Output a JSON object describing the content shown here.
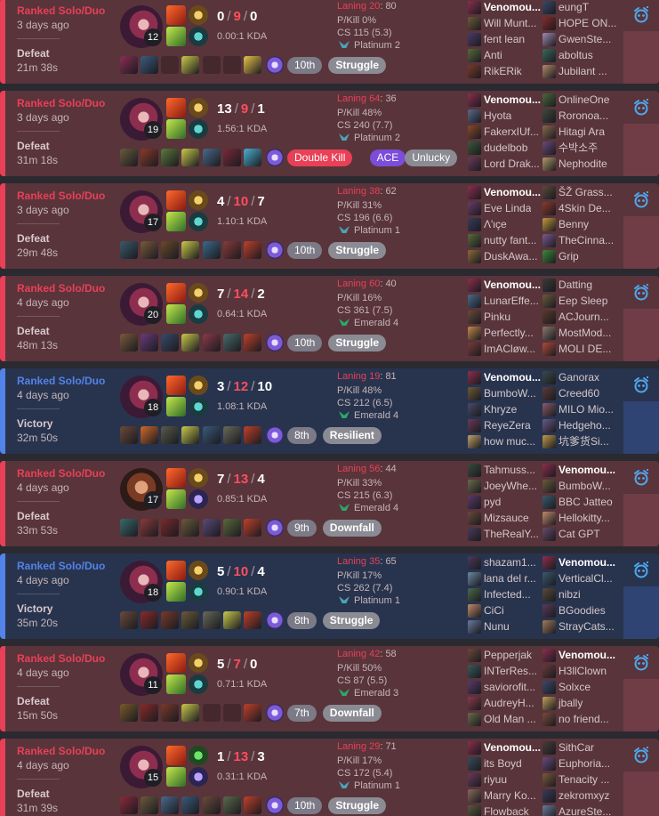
{
  "colors": {
    "defeat_accent": "#e84057",
    "victory_accent": "#5383e8",
    "defeat_bg": "#59343b",
    "victory_bg": "#28344e"
  },
  "matches": [
    {
      "result_class": "defeat",
      "queue": "Ranked Solo/Duo",
      "ago": "3 days ago",
      "result": "Defeat",
      "duration": "21m 38s",
      "champion": "c-irelia",
      "level": "12",
      "spells": [
        "spell-ignite",
        "spell-ghost"
      ],
      "runes": [
        "rune-conqueror",
        "rune-resolve"
      ],
      "kills": "0",
      "deaths": "9",
      "assists": "0",
      "kda_ratio": "0.00:1 KDA",
      "items": [
        "#8a2e52",
        "#3a5c7c",
        "empty",
        "#c9c94a",
        "empty",
        "empty",
        "#e7c34a",
        "ward"
      ],
      "badges": [
        {
          "text": "10th",
          "kind": "place"
        },
        {
          "text": "Struggle",
          "kind": "mood"
        }
      ],
      "laning_label": "Laning 20",
      "laning_rest": ": 80",
      "p_kill": "P/Kill 0%",
      "cs": "CS 115 (5.3)",
      "rank": "Platinum 2",
      "rank_emblem": "plat",
      "team1": [
        {
          "name": "Venomou...",
          "me": true,
          "c": "#8d2e4e"
        },
        {
          "name": "Will Munt...",
          "c": "#6e5a3a"
        },
        {
          "name": "fent lean",
          "c": "#4a3a6a"
        },
        {
          "name": "Anti",
          "c": "#5a6a3a"
        },
        {
          "name": "RikERik",
          "c": "#7a3a2a"
        }
      ],
      "team2": [
        {
          "name": "eungT",
          "c": "#3a4a6a"
        },
        {
          "name": "HOPE ON...",
          "c": "#8a2a2a"
        },
        {
          "name": "GwenSte...",
          "c": "#a08ab0"
        },
        {
          "name": "aboltus",
          "c": "#3a6a5a"
        },
        {
          "name": "Jubilant ...",
          "c": "#b08a6a"
        }
      ]
    },
    {
      "result_class": "defeat",
      "queue": "Ranked Solo/Duo",
      "ago": "3 days ago",
      "result": "Defeat",
      "duration": "31m 18s",
      "champion": "c-irelia",
      "level": "19",
      "spells": [
        "spell-ignite",
        "spell-ghost"
      ],
      "runes": [
        "rune-conqueror",
        "rune-resolve"
      ],
      "kills": "13",
      "deaths": "9",
      "assists": "1",
      "kda_ratio": "1.56:1 KDA",
      "items": [
        "#6a5a3a",
        "#8a3a2a",
        "#5a7a3a",
        "#c9c94a",
        "#4a6a8a",
        "#7a2a3a",
        "#4ab0d0",
        "ward"
      ],
      "badges": [
        {
          "text": "Double Kill",
          "kind": "multi"
        },
        {
          "text": "ACE",
          "kind": "ace"
        },
        {
          "text": "Unlucky",
          "kind": "unlucky"
        }
      ],
      "laning_label": "Laning 64",
      "laning_rest": ": 36",
      "p_kill": "P/Kill 48%",
      "cs": "CS 240 (7.7)",
      "rank": "Platinum 2",
      "rank_emblem": "plat",
      "team1": [
        {
          "name": "Venomou...",
          "me": true,
          "c": "#8d2e4e"
        },
        {
          "name": "Hyota",
          "c": "#5a6a8a"
        },
        {
          "name": "FakerxIUf...",
          "c": "#8a4a2a"
        },
        {
          "name": "dudelbob",
          "c": "#3a5a3a"
        },
        {
          "name": "Lord Drak...",
          "c": "#6a3a5a"
        }
      ],
      "team2": [
        {
          "name": "OnlineOne",
          "c": "#4a6a3a"
        },
        {
          "name": "Roronoa...",
          "c": "#3a4a3a"
        },
        {
          "name": "Hitagi Ara",
          "c": "#8a6a4a"
        },
        {
          "name": "수박소주",
          "c": "#6a4a7a"
        },
        {
          "name": "Nephodite",
          "c": "#b09a6a"
        }
      ]
    },
    {
      "result_class": "defeat",
      "queue": "Ranked Solo/Duo",
      "ago": "3 days ago",
      "result": "Defeat",
      "duration": "29m 48s",
      "champion": "c-irelia",
      "level": "17",
      "spells": [
        "spell-ignite",
        "spell-ghost"
      ],
      "runes": [
        "rune-conqueror",
        "rune-resolve"
      ],
      "kills": "4",
      "deaths": "10",
      "assists": "7",
      "kda_ratio": "1.10:1 KDA",
      "items": [
        "#3a5a6a",
        "#7a5a3a",
        "#6a4a2a",
        "#c9c94a",
        "#3a6a8a",
        "#8a3a3a",
        "#c0402a",
        "ward"
      ],
      "badges": [
        {
          "text": "10th",
          "kind": "place"
        },
        {
          "text": "Struggle",
          "kind": "mood"
        }
      ],
      "laning_label": "Laning 38",
      "laning_rest": ": 62",
      "p_kill": "P/Kill 31%",
      "cs": "CS 196 (6.6)",
      "rank": "Platinum 1",
      "rank_emblem": "plat",
      "team1": [
        {
          "name": "Venomou...",
          "me": true,
          "c": "#8d2e4e"
        },
        {
          "name": "Eve Linda",
          "c": "#6a3a6a"
        },
        {
          "name": "Λ'ιçe",
          "c": "#3a3a5a"
        },
        {
          "name": "nutty fant...",
          "c": "#5a6a3a"
        },
        {
          "name": "DuskAwa...",
          "c": "#8a6a3a"
        }
      ],
      "team2": [
        {
          "name": "ŠŽ Grass...",
          "c": "#5a4a3a"
        },
        {
          "name": "4Skin De...",
          "c": "#8a3a2a"
        },
        {
          "name": "Benny",
          "c": "#c09a3a"
        },
        {
          "name": "TheCinna...",
          "c": "#7a5a8a"
        },
        {
          "name": "Grip",
          "c": "#3a8a3a"
        }
      ]
    },
    {
      "result_class": "defeat",
      "queue": "Ranked Solo/Duo",
      "ago": "4 days ago",
      "result": "Defeat",
      "duration": "48m 13s",
      "champion": "c-irelia",
      "level": "20",
      "spells": [
        "spell-ignite",
        "spell-ghost"
      ],
      "runes": [
        "rune-conqueror",
        "rune-resolve"
      ],
      "kills": "7",
      "deaths": "14",
      "assists": "2",
      "kda_ratio": "0.64:1 KDA",
      "items": [
        "#7a5a3a",
        "#6a3a7a",
        "#3a4a6a",
        "#c9c94a",
        "#8a3a4a",
        "#4a6a6a",
        "#c0402a",
        "ward"
      ],
      "badges": [
        {
          "text": "10th",
          "kind": "place"
        },
        {
          "text": "Struggle",
          "kind": "mood"
        }
      ],
      "laning_label": "Laning 60",
      "laning_rest": ": 40",
      "p_kill": "P/Kill 16%",
      "cs": "CS 361 (7.5)",
      "rank": "Emerald 4",
      "rank_emblem": "emer",
      "team1": [
        {
          "name": "Venomou...",
          "me": true,
          "c": "#8d2e4e"
        },
        {
          "name": "LunarEffe...",
          "c": "#4a6a8a"
        },
        {
          "name": "Pinku",
          "c": "#6a4a3a"
        },
        {
          "name": "Perfectly...",
          "c": "#c08a4a"
        },
        {
          "name": "ImACløw...",
          "c": "#7a3a3a"
        }
      ],
      "team2": [
        {
          "name": "Datting",
          "c": "#3a3a3a"
        },
        {
          "name": "Eep Sleep",
          "c": "#6a5a3a"
        },
        {
          "name": "ACJourn...",
          "c": "#5a3a2a"
        },
        {
          "name": "MostMod...",
          "c": "#8a7a6a"
        },
        {
          "name": "MOLI DE...",
          "c": "#b04a3a"
        }
      ]
    },
    {
      "result_class": "victory",
      "queue": "Ranked Solo/Duo",
      "ago": "4 days ago",
      "result": "Victory",
      "duration": "32m 50s",
      "champion": "c-irelia",
      "level": "18",
      "spells": [
        "spell-ignite",
        "spell-ghost"
      ],
      "runes": [
        "rune-conqueror",
        "rune-resolve"
      ],
      "kills": "3",
      "deaths": "12",
      "assists": "10",
      "kda_ratio": "1.08:1 KDA",
      "items": [
        "#6a4a3a",
        "#d06a2a",
        "#5a5a4a",
        "#c9c94a",
        "#3a5a7a",
        "#6a6a5a",
        "#c0402a",
        "ward"
      ],
      "badges": [
        {
          "text": "8th",
          "kind": "place"
        },
        {
          "text": "Resilient",
          "kind": "mood"
        }
      ],
      "laning_label": "Laning 19",
      "laning_rest": ": 81",
      "p_kill": "P/Kill 48%",
      "cs": "CS 212 (6.5)",
      "rank": "Emerald 4",
      "rank_emblem": "emer",
      "team1": [
        {
          "name": "Venomou...",
          "me": true,
          "c": "#8d2e4e"
        },
        {
          "name": "BumboW...",
          "c": "#6a5a3a"
        },
        {
          "name": "Khryze",
          "c": "#4a4a6a"
        },
        {
          "name": "ReyeZera",
          "c": "#6a3a5a"
        },
        {
          "name": "how muc...",
          "c": "#c0a06a"
        }
      ],
      "team2": [
        {
          "name": "Ganorax",
          "c": "#3a4a4a"
        },
        {
          "name": "Creed60",
          "c": "#5a3a3a"
        },
        {
          "name": "MILO Mio...",
          "c": "#8a5a6a"
        },
        {
          "name": "Hedgeho...",
          "c": "#6a5a8a"
        },
        {
          "name": "坑爹货Si...",
          "c": "#c09a4a"
        }
      ]
    },
    {
      "result_class": "defeat",
      "queue": "Ranked Solo/Duo",
      "ago": "4 days ago",
      "result": "Defeat",
      "duration": "33m 53s",
      "champion": "c-darius",
      "level": "17",
      "spells": [
        "spell-ignite",
        "spell-ghost"
      ],
      "runes": [
        "rune-conqueror",
        "rune-sorcery"
      ],
      "kills": "7",
      "deaths": "13",
      "assists": "4",
      "kda_ratio": "0.85:1 KDA",
      "items": [
        "#3a6a6a",
        "#8a3a3a",
        "#7a2a2a",
        "#6a5a3a",
        "#5a4a7a",
        "#5a6a3a",
        "#c0402a",
        "ward"
      ],
      "badges": [
        {
          "text": "9th",
          "kind": "place"
        },
        {
          "text": "Downfall",
          "kind": "mood"
        }
      ],
      "laning_label": "Laning 56",
      "laning_rest": ": 44",
      "p_kill": "P/Kill 33%",
      "cs": "CS 215 (6.3)",
      "rank": "Emerald 4",
      "rank_emblem": "emer",
      "team1": [
        {
          "name": "Tahmuss...",
          "c": "#3a4a3a"
        },
        {
          "name": "JoeyWhe...",
          "c": "#6a6a4a"
        },
        {
          "name": "pyd",
          "c": "#5a3a6a"
        },
        {
          "name": "Mizsauce",
          "c": "#6a4a3a"
        },
        {
          "name": "TheRealY...",
          "c": "#4a3a5a"
        }
      ],
      "team2": [
        {
          "name": "Venomou...",
          "me": true,
          "c": "#8d2e4e"
        },
        {
          "name": "BumboW...",
          "c": "#6a5a3a"
        },
        {
          "name": "BBC Jatteo",
          "c": "#3a5a6a"
        },
        {
          "name": "Hellokitty...",
          "c": "#c08a6a"
        },
        {
          "name": "Cat GPT",
          "c": "#6a4a6a"
        }
      ]
    },
    {
      "result_class": "victory",
      "queue": "Ranked Solo/Duo",
      "ago": "4 days ago",
      "result": "Victory",
      "duration": "35m 20s",
      "champion": "c-irelia",
      "level": "18",
      "spells": [
        "spell-ignite",
        "spell-ghost"
      ],
      "runes": [
        "rune-conqueror",
        "rune-resolve"
      ],
      "kills": "5",
      "deaths": "10",
      "assists": "4",
      "kda_ratio": "0.90:1 KDA",
      "items": [
        "#6a4a3a",
        "#8a2a2a",
        "#7a3a2a",
        "#6a5a3a",
        "#6a6a5a",
        "#c9c94a",
        "#c0402a",
        "ward"
      ],
      "badges": [
        {
          "text": "8th",
          "kind": "place"
        },
        {
          "text": "Struggle",
          "kind": "mood"
        }
      ],
      "laning_label": "Laning 35",
      "laning_rest": ": 65",
      "p_kill": "P/Kill 17%",
      "cs": "CS 262 (7.4)",
      "rank": "Platinum 1",
      "rank_emblem": "plat",
      "team1": [
        {
          "name": "shazam1...",
          "c": "#4a3a5a"
        },
        {
          "name": "lana del r...",
          "c": "#6a8aa0"
        },
        {
          "name": "Infected...",
          "c": "#4a6a4a"
        },
        {
          "name": "CiCi",
          "c": "#c08a6a"
        },
        {
          "name": "Nunu",
          "c": "#6a7aa0"
        }
      ],
      "team2": [
        {
          "name": "Venomou...",
          "me": true,
          "c": "#8d2e4e"
        },
        {
          "name": "VerticalCl...",
          "c": "#3a5a6a"
        },
        {
          "name": "nibzi",
          "c": "#5a4a3a"
        },
        {
          "name": "BGoodies",
          "c": "#5a3a5a"
        },
        {
          "name": "StrayCats...",
          "c": "#a07a5a"
        }
      ]
    },
    {
      "result_class": "defeat",
      "queue": "Ranked Solo/Duo",
      "ago": "4 days ago",
      "result": "Defeat",
      "duration": "15m 50s",
      "champion": "c-irelia",
      "level": "11",
      "spells": [
        "spell-ignite",
        "spell-ghost"
      ],
      "runes": [
        "rune-conqueror",
        "rune-resolve"
      ],
      "kills": "5",
      "deaths": "7",
      "assists": "0",
      "kda_ratio": "0.71:1 KDA",
      "items": [
        "#7a5a2a",
        "#8a2a2a",
        "#7a3a2a",
        "#c9c94a",
        "empty",
        "empty",
        "#c0402a",
        "ward"
      ],
      "badges": [
        {
          "text": "7th",
          "kind": "place"
        },
        {
          "text": "Downfall",
          "kind": "mood"
        }
      ],
      "laning_label": "Laning 42",
      "laning_rest": ": 58",
      "p_kill": "P/Kill 50%",
      "cs": "CS 87 (5.5)",
      "rank": "Emerald 3",
      "rank_emblem": "emer",
      "team1": [
        {
          "name": "Pepperjak",
          "c": "#6a4a3a"
        },
        {
          "name": "INTerRes...",
          "c": "#3a5a5a"
        },
        {
          "name": "saviorofit...",
          "c": "#5a3a6a"
        },
        {
          "name": "AudreyH...",
          "c": "#8a3a4a"
        },
        {
          "name": "Old Man ...",
          "c": "#6a6a4a"
        }
      ],
      "team2": [
        {
          "name": "Venomou...",
          "me": true,
          "c": "#8d2e4e"
        },
        {
          "name": "H3llClown",
          "c": "#6a3a3a"
        },
        {
          "name": "Solxce",
          "c": "#3a4a6a"
        },
        {
          "name": "jbally",
          "c": "#c0a05a"
        },
        {
          "name": "no friend...",
          "c": "#7a4a3a"
        }
      ]
    },
    {
      "result_class": "defeat",
      "queue": "Ranked Solo/Duo",
      "ago": "4 days ago",
      "result": "Defeat",
      "duration": "31m 39s",
      "champion": "c-irelia",
      "level": "15",
      "spells": [
        "spell-ignite",
        "spell-ghost"
      ],
      "runes": [
        "rune-grasp",
        "rune-sorcery"
      ],
      "kills": "1",
      "deaths": "13",
      "assists": "3",
      "kda_ratio": "0.31:1 KDA",
      "items": [
        "#8a2a3a",
        "#6a5a3a",
        "#4a6a8a",
        "#3a5a7a",
        "#6a4a3a",
        "#5a6a4a",
        "#c0402a",
        "ward"
      ],
      "badges": [
        {
          "text": "10th",
          "kind": "place"
        },
        {
          "text": "Struggle",
          "kind": "mood"
        }
      ],
      "laning_label": "Laning 29",
      "laning_rest": ": 71",
      "p_kill": "P/Kill 17%",
      "cs": "CS 172 (5.4)",
      "rank": "Platinum 1",
      "rank_emblem": "plat",
      "team1": [
        {
          "name": "Venomou...",
          "me": true,
          "c": "#8d2e4e"
        },
        {
          "name": "its Boyd",
          "c": "#3a4a5a"
        },
        {
          "name": "riyuu",
          "c": "#6a3a5a"
        },
        {
          "name": "Marry Ko...",
          "c": "#8a6a5a"
        },
        {
          "name": "Flowback",
          "c": "#5a5a3a"
        }
      ],
      "team2": [
        {
          "name": "SithCar",
          "c": "#4a3a3a"
        },
        {
          "name": "Euphoria...",
          "c": "#6a4a7a"
        },
        {
          "name": "Tenacity ...",
          "c": "#7a5a3a"
        },
        {
          "name": "zekromxyz",
          "c": "#3a3a5a"
        },
        {
          "name": "AzureSte...",
          "c": "#6a7a9a"
        }
      ]
    }
  ]
}
